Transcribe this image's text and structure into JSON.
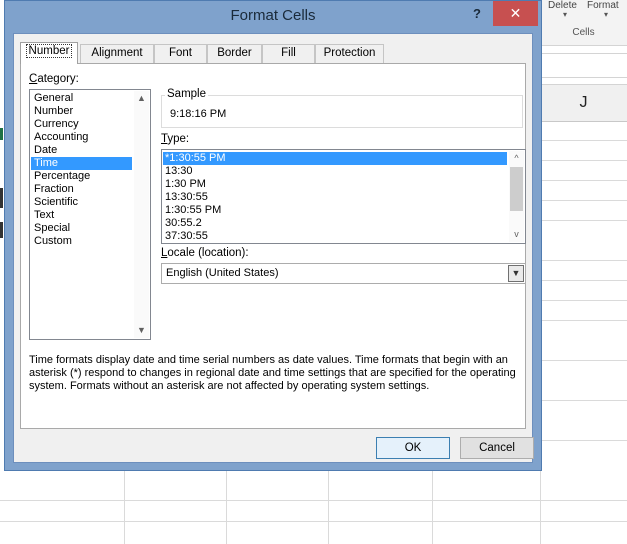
{
  "background": {
    "ribbon": {
      "delete_label": "Delete",
      "format_label": "Format",
      "group_label": "Cells"
    },
    "column_header": "J"
  },
  "dialog": {
    "title": "Format Cells",
    "help_glyph": "?",
    "close_glyph": "✕",
    "tabs": [
      {
        "label": "Number",
        "active": true
      },
      {
        "label": "Alignment"
      },
      {
        "label": "Font"
      },
      {
        "label": "Border"
      },
      {
        "label": "Fill"
      },
      {
        "label": "Protection"
      }
    ],
    "category": {
      "label_underlined": "C",
      "label_rest": "ategory:",
      "items": [
        "General",
        "Number",
        "Currency",
        "Accounting",
        "Date",
        "Time",
        "Percentage",
        "Fraction",
        "Scientific",
        "Text",
        "Special",
        "Custom"
      ],
      "selected": "Time"
    },
    "sample": {
      "label": "Sample",
      "value": "9:18:16 PM"
    },
    "type": {
      "label_underlined": "T",
      "label_rest": "ype:",
      "items": [
        "*1:30:55 PM",
        "13:30",
        "1:30 PM",
        "13:30:55",
        "1:30:55 PM",
        "30:55.2",
        "37:30:55"
      ],
      "selected": "*1:30:55 PM"
    },
    "locale": {
      "label_underlined": "L",
      "label_rest": "ocale (location):",
      "value": "English (United States)"
    },
    "description": "Time formats display date and time serial numbers as date values.  Time formats that begin with an asterisk (*) respond to changes in regional date and time settings that are specified for the operating system. Formats without an asterisk are not affected by operating system settings.",
    "ok_label": "OK",
    "cancel_label": "Cancel"
  },
  "colors": {
    "dialog_frame": "#7fa2cc",
    "close_button": "#c75050",
    "selection": "#3399ff"
  }
}
